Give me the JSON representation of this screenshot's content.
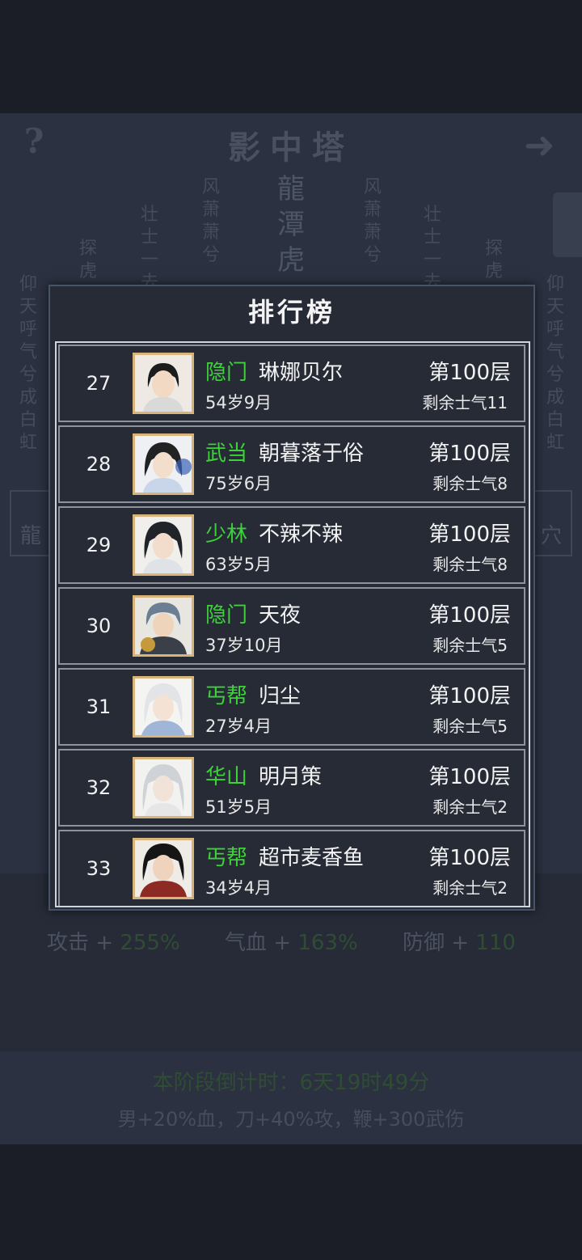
{
  "background": {
    "tower_title": "影中塔",
    "poem_columns": [
      "仰天呼气兮成白虹",
      "探虎",
      "壮士一去",
      "风萧萧兮",
      "龍潭虎",
      "风萧萧兮",
      "壮士一去",
      "探虎",
      "仰天呼气兮成白虹"
    ],
    "left_box": "龍",
    "right_box": "穴",
    "stats": [
      {
        "label": "攻击 + ",
        "value": "255%"
      },
      {
        "label": "气血 + ",
        "value": "163%"
      },
      {
        "label": "防御 + ",
        "value": "110"
      }
    ],
    "countdown": "本阶段倒计时：6天19时49分",
    "bonus": "男+20%血，刀+40%攻，鞭+300武伤"
  },
  "leaderboard": {
    "title": "排行榜",
    "rows": [
      {
        "rank": "27",
        "sect": "隐门",
        "name": "琳娜贝尔",
        "age": "54岁9月",
        "floor": "第100层",
        "morale": "剩余士气11",
        "avatar": "avatar-icon"
      },
      {
        "rank": "28",
        "sect": "武当",
        "name": "朝暮落于俗",
        "age": "75岁6月",
        "floor": "第100层",
        "morale": "剩余士气8",
        "avatar": "avatar-icon"
      },
      {
        "rank": "29",
        "sect": "少林",
        "name": "不辣不辣",
        "age": "63岁5月",
        "floor": "第100层",
        "morale": "剩余士气8",
        "avatar": "avatar-icon"
      },
      {
        "rank": "30",
        "sect": "隐门",
        "name": "天夜",
        "age": "37岁10月",
        "floor": "第100层",
        "morale": "剩余士气5",
        "avatar": "avatar-icon"
      },
      {
        "rank": "31",
        "sect": "丐帮",
        "name": "归尘",
        "age": "27岁4月",
        "floor": "第100层",
        "morale": "剩余士气5",
        "avatar": "avatar-icon"
      },
      {
        "rank": "32",
        "sect": "华山",
        "name": "明月策",
        "age": "51岁5月",
        "floor": "第100层",
        "morale": "剩余士气2",
        "avatar": "avatar-icon"
      },
      {
        "rank": "33",
        "sect": "丐帮",
        "name": "超市麦香鱼",
        "age": "34岁4月",
        "floor": "第100层",
        "morale": "剩余士气2",
        "avatar": "avatar-icon"
      }
    ]
  },
  "colors": {
    "sect_green": "#3ed13a",
    "panel_bg": "#262b36",
    "avatar_border": "#d8b37a"
  }
}
